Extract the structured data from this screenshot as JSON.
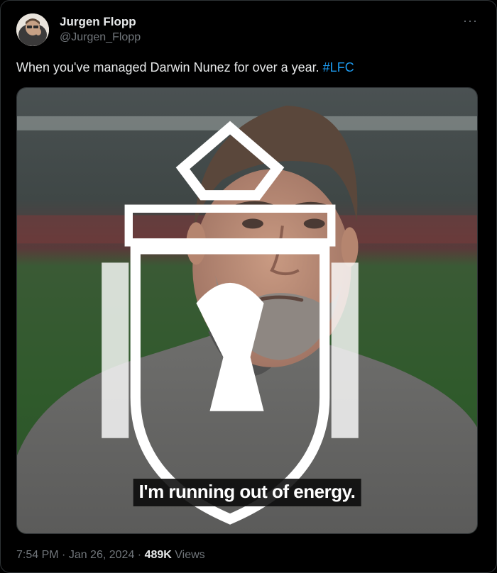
{
  "author": {
    "display_name": "Jurgen Flopp",
    "handle": "@Jurgen_Flopp"
  },
  "more_icon": "more-horizontal-icon",
  "tweet": {
    "text": "When you've managed Darwin Nunez for over a year. ",
    "hashtag": "#LFC"
  },
  "media": {
    "subtitle": "I'm running out of energy.",
    "crest_icon": "liverpool-crest-icon"
  },
  "meta": {
    "time": "7:54 PM",
    "separator1": " · ",
    "date": "Jan 26, 2024",
    "separator2": " · ",
    "views_count": "489K",
    "views_label": " Views"
  },
  "colors": {
    "background": "#000000",
    "text": "#e7e9ea",
    "secondary": "#71767b",
    "link": "#1d9bf0"
  }
}
